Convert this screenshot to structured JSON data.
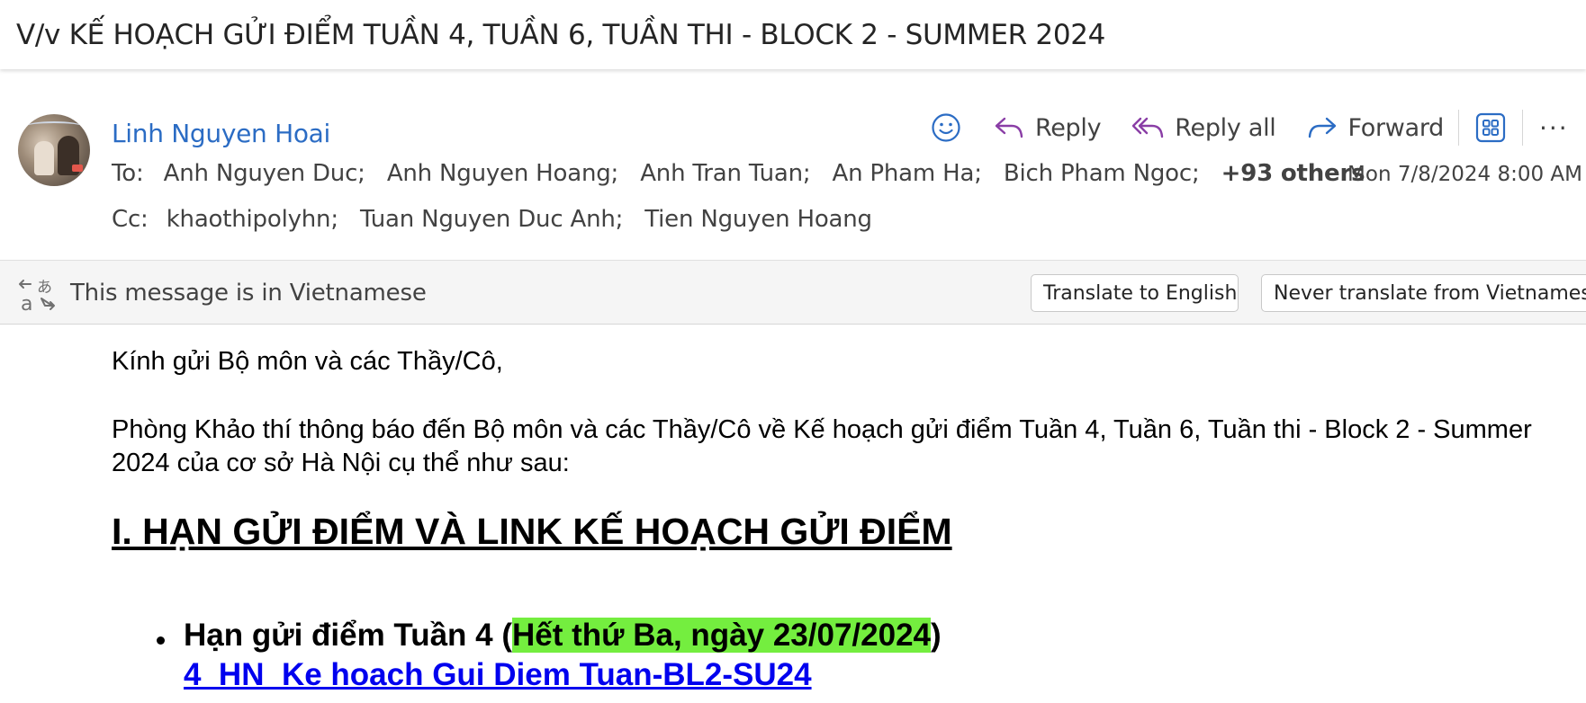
{
  "email": {
    "subject": "V/v KẾ HOẠCH GỬI ĐIỂM TUẦN 4, TUẦN 6, TUẦN THI - BLOCK 2 - SUMMER 2024",
    "sender": "Linh Nguyen Hoai",
    "to_label": "To:",
    "to": [
      "Anh Nguyen Duc;",
      "Anh Nguyen Hoang;",
      "Anh Tran Tuan;",
      "An Pham Ha;",
      "Bich Pham Ngoc;"
    ],
    "to_others": "+93 others",
    "cc_label": "Cc:",
    "cc": [
      "khaothipolyhn;",
      "Tuan Nguyen Duc Anh;",
      "Tien Nguyen Hoang"
    ],
    "date": "Mon 7/8/2024 8:00 AM"
  },
  "actions": {
    "emoji_icon": "smiley-icon",
    "reply": "Reply",
    "reply_all": "Reply all",
    "forward": "Forward",
    "apps_icon": "apps-icon",
    "more": "···"
  },
  "translate": {
    "icon": "translate-icon",
    "message": "This message is in Vietnamese",
    "translate_button": "Translate to English",
    "never_button": "Never translate from Vietnamese"
  },
  "body": {
    "greeting": "Kính gửi Bộ môn và các Thầy/Cô,",
    "paragraph": "Phòng Khảo thí thông báo đến Bộ môn và các Thầy/Cô về Kế hoạch gửi điểm Tuần 4, Tuần 6, Tuần thi - Block 2 - Summer 2024 của cơ sở Hà Nội cụ thể như sau:",
    "section_heading": "I. HẠN GỬI ĐIỂM VÀ LINK KẾ HOẠCH GỬI ĐIỂM",
    "bullet_prefix": "Hạn gửi điểm Tuần 4 (",
    "bullet_highlight": "Hết thứ Ba, ngày 23/07/2024",
    "bullet_suffix": ")",
    "link": "4_HN_Ke hoach Gui Diem Tuan-BL2-SU24"
  },
  "colors": {
    "sender": "#2b6cc4",
    "accent_icons": "#8a3ea6",
    "forward_icon": "#2b6cc4",
    "highlight": "#74ee3f",
    "link": "#0000ee"
  }
}
